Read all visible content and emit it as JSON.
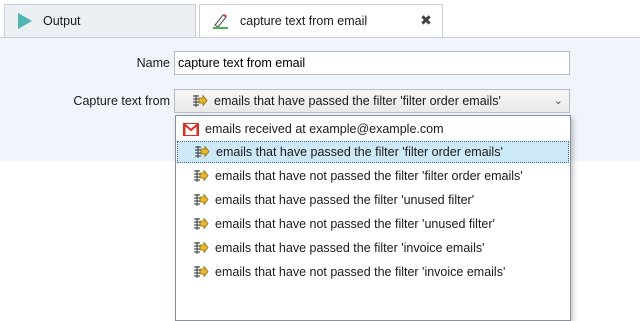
{
  "tabs": [
    {
      "label": "Output",
      "icon": "play-triangle-icon"
    },
    {
      "label": "capture text from email",
      "icon": "pencil-edit-icon",
      "close_glyph": "✖"
    }
  ],
  "form": {
    "name_label": "Name",
    "name_value": "capture text from email",
    "capture_label": "Capture text from",
    "capture_selected": "emails that have passed the filter 'filter order emails'",
    "chevron": "⌄"
  },
  "dropdown": {
    "options": [
      {
        "label": "emails received at example@example.com",
        "icon": "gmail-icon"
      },
      {
        "label": "emails that have passed the filter 'filter order emails'",
        "icon": "filter-arrow-icon",
        "selected": true
      },
      {
        "label": "emails that have not passed the filter 'filter order emails'",
        "icon": "filter-arrow-icon"
      },
      {
        "label": "emails that have passed the filter 'unused filter'",
        "icon": "filter-arrow-icon"
      },
      {
        "label": "emails that have not passed the filter 'unused filter'",
        "icon": "filter-arrow-icon"
      },
      {
        "label": "emails that have passed the filter 'invoice emails'",
        "icon": "filter-arrow-icon"
      },
      {
        "label": "emails that have not passed the filter 'invoice emails'",
        "icon": "filter-arrow-icon"
      }
    ]
  },
  "colors": {
    "accent_teal": "#4fb6b3",
    "filter_icon_yellow": "#e8b72a",
    "gmail_red": "#d93025",
    "selection_bg": "#cde8f7",
    "panel_bg": "#f0f5fb"
  }
}
